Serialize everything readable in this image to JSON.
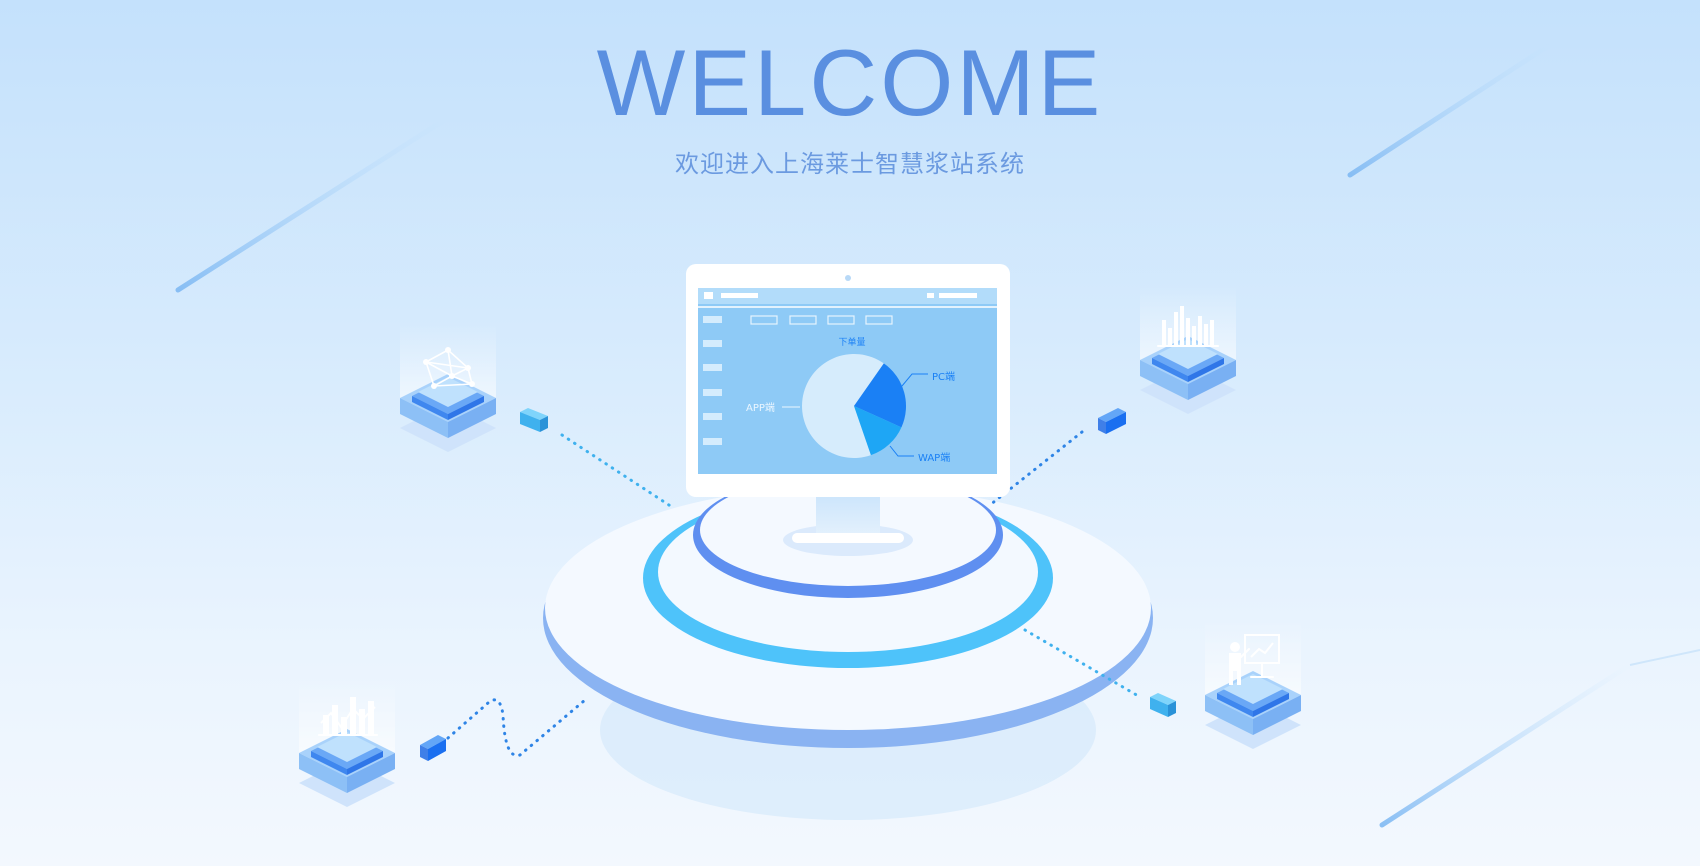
{
  "header": {
    "title": "WELCOME",
    "subtitle": "欢迎进入上海莱士智慧浆站系统"
  },
  "monitor": {
    "chart_title": "下单量",
    "chart_data": {
      "type": "pie",
      "slices": [
        {
          "label": "APP端",
          "value": 65
        },
        {
          "label": "PC端",
          "value": 22
        },
        {
          "label": "WAP端",
          "value": 13
        }
      ]
    }
  },
  "icons": {
    "top_left": "network-icon",
    "top_right": "bar-chart-icon",
    "bottom_left": "bar-line-chart-icon",
    "bottom_right": "presentation-icon"
  },
  "colors": {
    "title": "#5a8fe0",
    "accent": "#1a80f5",
    "ring_inner": "#4ec3fa",
    "ring_top": "#5f8ff0",
    "screen": "#8ecaf6"
  }
}
